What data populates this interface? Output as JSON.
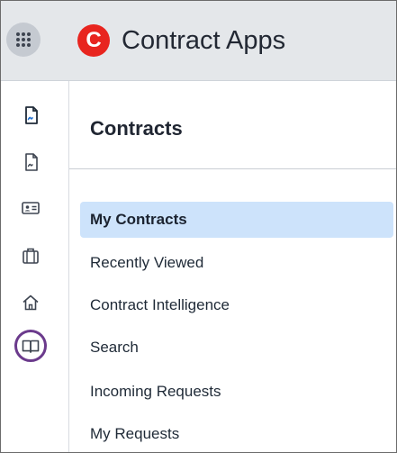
{
  "header": {
    "app_title": "Contract Apps",
    "logo_letter": "C",
    "brand_color": "#e8251f",
    "waffle_icon": "app-launcher-grid-icon"
  },
  "sidebar": {
    "icons": [
      {
        "name": "contract-document-icon",
        "active": true
      },
      {
        "name": "document-icon",
        "active": false
      },
      {
        "name": "id-card-icon",
        "active": false
      },
      {
        "name": "briefcase-icon",
        "active": false
      },
      {
        "name": "home-icon",
        "active": false
      },
      {
        "name": "book-icon",
        "active": false,
        "highlighted": true
      }
    ],
    "highlight_color": "#6b3a8c"
  },
  "panel": {
    "title": "Contracts",
    "items": [
      {
        "label": "My Contracts",
        "active": true
      },
      {
        "label": "Recently Viewed"
      },
      {
        "label": "Contract Intelligence"
      },
      {
        "label": "Search"
      },
      {
        "label": "Incoming Requests"
      },
      {
        "label": "My Requests"
      }
    ],
    "active_color": "#cde3fb"
  }
}
